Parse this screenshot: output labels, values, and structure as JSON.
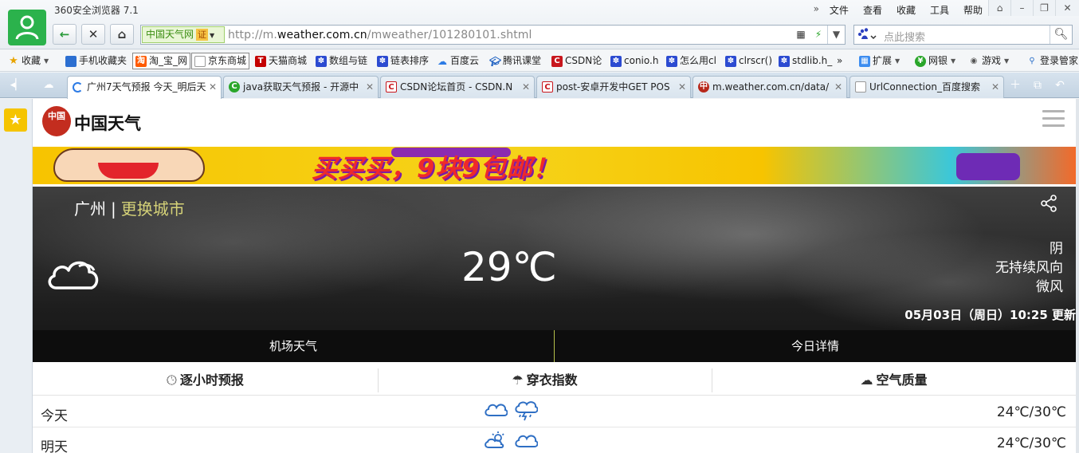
{
  "browser": {
    "title": "360安全浏览器 7.1",
    "menu": [
      "文件",
      "查看",
      "收藏",
      "工具",
      "帮助"
    ],
    "menu_more": "»",
    "window_controls": [
      "⌂",
      "–",
      "❐",
      "✕"
    ]
  },
  "address_bar": {
    "site_badge": "中国天气网",
    "cert": "证",
    "url_prefix": "http://m.",
    "url_domain": "weather.com.cn",
    "url_path": "/mweather/101280101.shtml"
  },
  "search": {
    "engine_icon": "paw-icon",
    "placeholder": "点此搜索"
  },
  "bookmarks": [
    {
      "label": "收藏",
      "icon": "star"
    },
    {
      "label": "手机收藏夹",
      "icon": "phone"
    },
    {
      "label": "淘_宝_网",
      "icon": "taobao"
    },
    {
      "label": "京东商城",
      "icon": "doc"
    },
    {
      "label": "天猫商城",
      "icon": "tmall"
    },
    {
      "label": "数组与链",
      "icon": "paw"
    },
    {
      "label": "链表排序",
      "icon": "paw"
    },
    {
      "label": "百度云",
      "icon": "cloud"
    },
    {
      "label": "腾讯课堂",
      "icon": "grad"
    },
    {
      "label": "CSDN论",
      "icon": "csdn"
    },
    {
      "label": "conio.h",
      "icon": "paw"
    },
    {
      "label": "怎么用cl",
      "icon": "paw"
    },
    {
      "label": "clrscr()",
      "icon": "paw"
    },
    {
      "label": "stdlib.h_",
      "icon": "paw"
    },
    {
      "label": "»",
      "icon": "none"
    },
    {
      "label": "扩展",
      "icon": "grid"
    },
    {
      "label": "网银",
      "icon": "money"
    },
    {
      "label": "游戏",
      "icon": "game"
    },
    {
      "label": "登录管家",
      "icon": "shield"
    }
  ],
  "tabs": [
    {
      "label": "广州7天气预报 今天_明后天",
      "favicon": "spin",
      "active": true
    },
    {
      "label": "java获取天气预报 - 开源中",
      "favicon": "java",
      "active": false
    },
    {
      "label": "CSDN论坛首页 - CSDN.N",
      "favicon": "csdn",
      "active": false
    },
    {
      "label": "post-安卓开发中GET POS",
      "favicon": "csdn",
      "active": false
    },
    {
      "label": "m.weather.com.cn/data/",
      "favicon": "weather",
      "active": false
    },
    {
      "label": "UrlConnection_百度搜索",
      "favicon": "doc",
      "active": false
    }
  ],
  "page": {
    "brand": "中国天气",
    "seal": "中国",
    "banner_text": "买买买，9块9包邮！",
    "city": "广州",
    "city_sep": "|",
    "change_city": "更换城市",
    "temperature": "29℃",
    "condition": "阴",
    "wind_direction": "无持续风向",
    "wind_level": "微风",
    "updated": "05月03日（周日）10:25 更新",
    "subnav": [
      "机场天气",
      "今日详情"
    ],
    "sections": [
      {
        "label": "逐小时预报",
        "icon": "clock-icon"
      },
      {
        "label": "穿衣指数",
        "icon": "umbrella-icon"
      },
      {
        "label": "空气质量",
        "icon": "cloud-icon"
      }
    ],
    "forecast": [
      {
        "day": "今天",
        "range": "24℃/30℃"
      },
      {
        "day": "明天",
        "range": "24℃/30℃"
      }
    ]
  }
}
